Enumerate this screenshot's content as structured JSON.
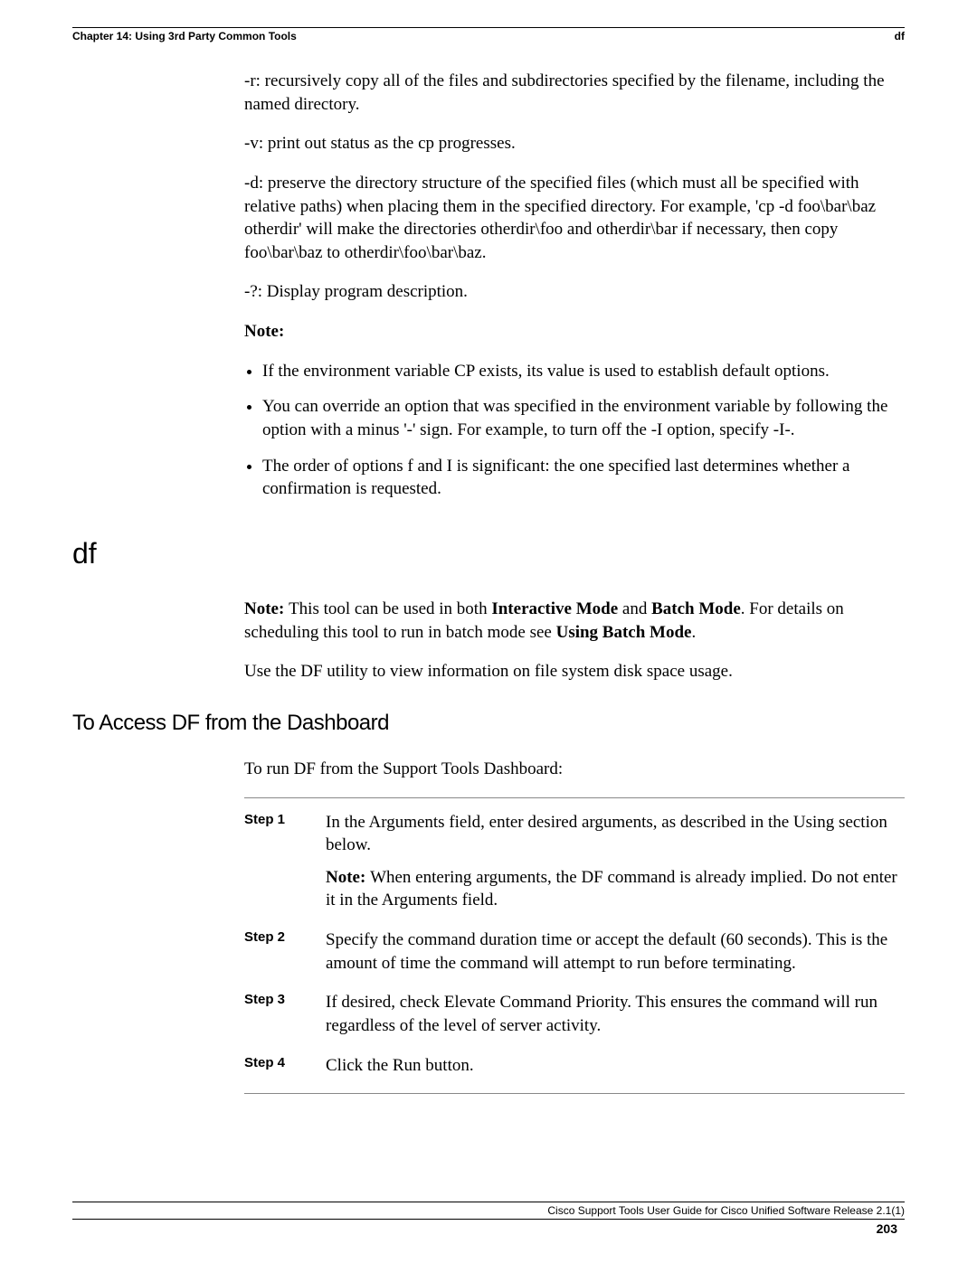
{
  "header": {
    "chapter": "Chapter 14: Using 3rd Party Common Tools",
    "section_label": "df"
  },
  "cp_options": {
    "r": "-r: recursively copy all of the files and subdirectories specified by the filename, including the named directory.",
    "v": "-v: print out status as the cp progresses.",
    "d": "-d: preserve the directory structure of the specified files (which must all be specified with relative paths) when placing them in the specified directory. For example, 'cp -d foo\\bar\\baz otherdir' will make the directories otherdir\\foo and otherdir\\bar if necessary, then copy foo\\bar\\baz to otherdir\\foo\\bar\\baz.",
    "q": "-?: Display program description.",
    "note_label": "Note:",
    "notes": [
      "If the environment variable CP exists, its value is used to establish default options.",
      "You can override an option that was specified in the environment variable by following the option with a minus '-' sign. For example, to turn off the -I option, specify -I-.",
      "The order of options f and I is significant: the one specified last determines whether a confirmation is requested."
    ]
  },
  "df_section": {
    "heading": "df",
    "note_prefix": "Note: ",
    "note_text_1": "This tool can be used in both ",
    "interactive": "Interactive Mode",
    "and": " and ",
    "batch": "Batch Mode",
    "note_text_2": ". For details on scheduling this tool to run in batch mode see ",
    "using_batch": "Using Batch Mode",
    "note_text_3": ".",
    "desc": "Use the DF utility to view information on file system disk space usage."
  },
  "access_section": {
    "heading": "To Access DF from the Dashboard",
    "intro": "To run DF from the Support Tools Dashboard:",
    "steps": [
      {
        "label": "Step 1",
        "body": "In the Arguments field, enter desired arguments, as described in the Using section below.",
        "sub_prefix": "Note: ",
        "sub": "When entering arguments, the DF command is already implied. Do not enter it in the Arguments field."
      },
      {
        "label": "Step 2",
        "body": "Specify the command duration time or accept the default (60 seconds). This is the amount of time the command will attempt to run before terminating."
      },
      {
        "label": "Step 3",
        "body": "If desired, check Elevate Command Priority. This ensures the command will run regardless of the level of server activity."
      },
      {
        "label": "Step 4",
        "body": "Click the Run button."
      }
    ]
  },
  "footer": {
    "doc_title": "Cisco Support Tools User Guide for Cisco Unified Software Release 2.1(1)",
    "page": "203"
  }
}
